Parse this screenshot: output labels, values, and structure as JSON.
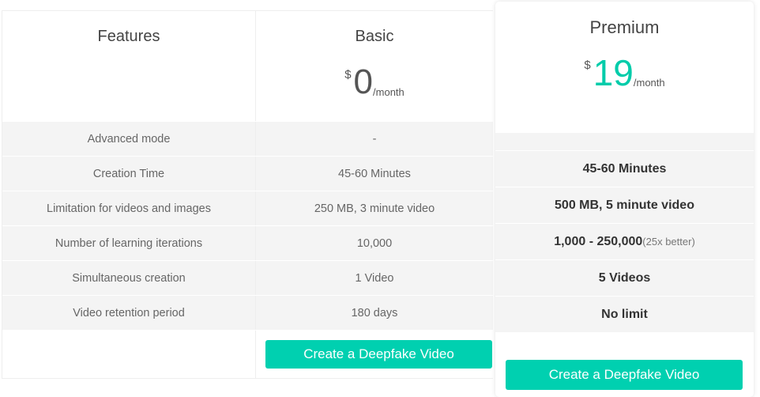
{
  "features_header": "Features",
  "basic": {
    "title": "Basic",
    "currency": "$",
    "price": "0",
    "period": "/month",
    "values": [
      "-",
      "45-60 Minutes",
      "250 MB, 3 minute video",
      "10,000",
      "1 Video",
      "180 days"
    ],
    "cta": "Create a Deepfake Video"
  },
  "features": [
    "Advanced mode",
    "Creation Time",
    "Limitation for videos and images",
    "Number of learning iterations",
    "Simultaneous creation",
    "Video retention period"
  ],
  "premium": {
    "title": "Premium",
    "currency": "$",
    "price": "19",
    "period": "/month",
    "values": [
      "",
      "45-60 Minutes",
      "500 MB, 5 minute video",
      "1,000 - 250,000",
      "5 Videos",
      "No limit"
    ],
    "iterations_note": "(25x better)",
    "cta": "Create a Deepfake Video"
  },
  "accent": "#00d0b0"
}
